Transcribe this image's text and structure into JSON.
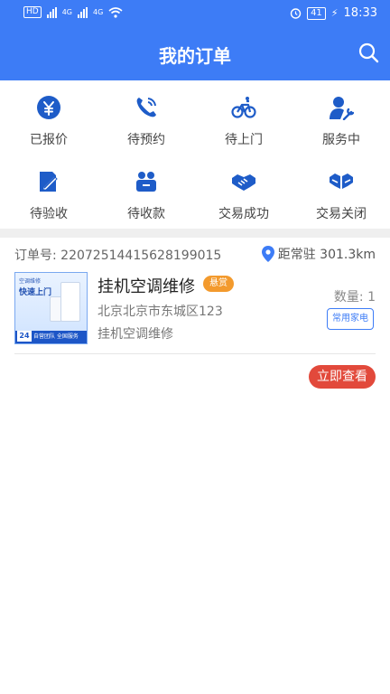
{
  "status_bar": {
    "hd_badge": "HD",
    "network_1": "4G",
    "network_2": "4G",
    "battery": "41",
    "time": "18:33"
  },
  "header": {
    "title": "我的订单",
    "search_icon": "search-icon",
    "color": "#3D7CF6"
  },
  "status_tabs": [
    {
      "label": "已报价",
      "icon": "yuan-icon"
    },
    {
      "label": "待预约",
      "icon": "phone-icon"
    },
    {
      "label": "待上门",
      "icon": "bicycle-icon"
    },
    {
      "label": "服务中",
      "icon": "repair-person-icon"
    },
    {
      "label": "待验收",
      "icon": "document-edit-icon"
    },
    {
      "label": "待收款",
      "icon": "wallet-icon"
    },
    {
      "label": "交易成功",
      "icon": "handshake-icon"
    },
    {
      "label": "交易关闭",
      "icon": "handshake-closed-icon"
    }
  ],
  "order": {
    "order_no_label": "订单号:",
    "order_no": "22072514415628199015",
    "distance": "距常驻 301.3km",
    "thumbnail": {
      "top_text": "空调维修",
      "headline": "快速上门",
      "hours": "24",
      "bottom_text": "自营团队 全国服务"
    },
    "service_name": "挂机空调维修",
    "reward_tag": "悬赏",
    "address": "北京北京市东城区123",
    "description": "挂机空调维修",
    "quantity": "数量:  1",
    "category": "常用家电",
    "view_button": "立即查看"
  }
}
